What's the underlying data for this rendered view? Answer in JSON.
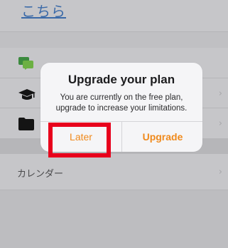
{
  "background": {
    "link_text": "こちら",
    "calendar_label": "カレンダー",
    "chevron": "›"
  },
  "dialog": {
    "title": "Upgrade your plan",
    "message": "You are currently on the free plan, upgrade to increase your limitations.",
    "later_label": "Later",
    "upgrade_label": "Upgrade"
  },
  "colors": {
    "accent": "#f08a1c",
    "highlight": "#e8001c",
    "link": "#3b6aa8"
  },
  "icons": [
    "chat-icon",
    "graduation-cap-icon",
    "folder-icon"
  ]
}
